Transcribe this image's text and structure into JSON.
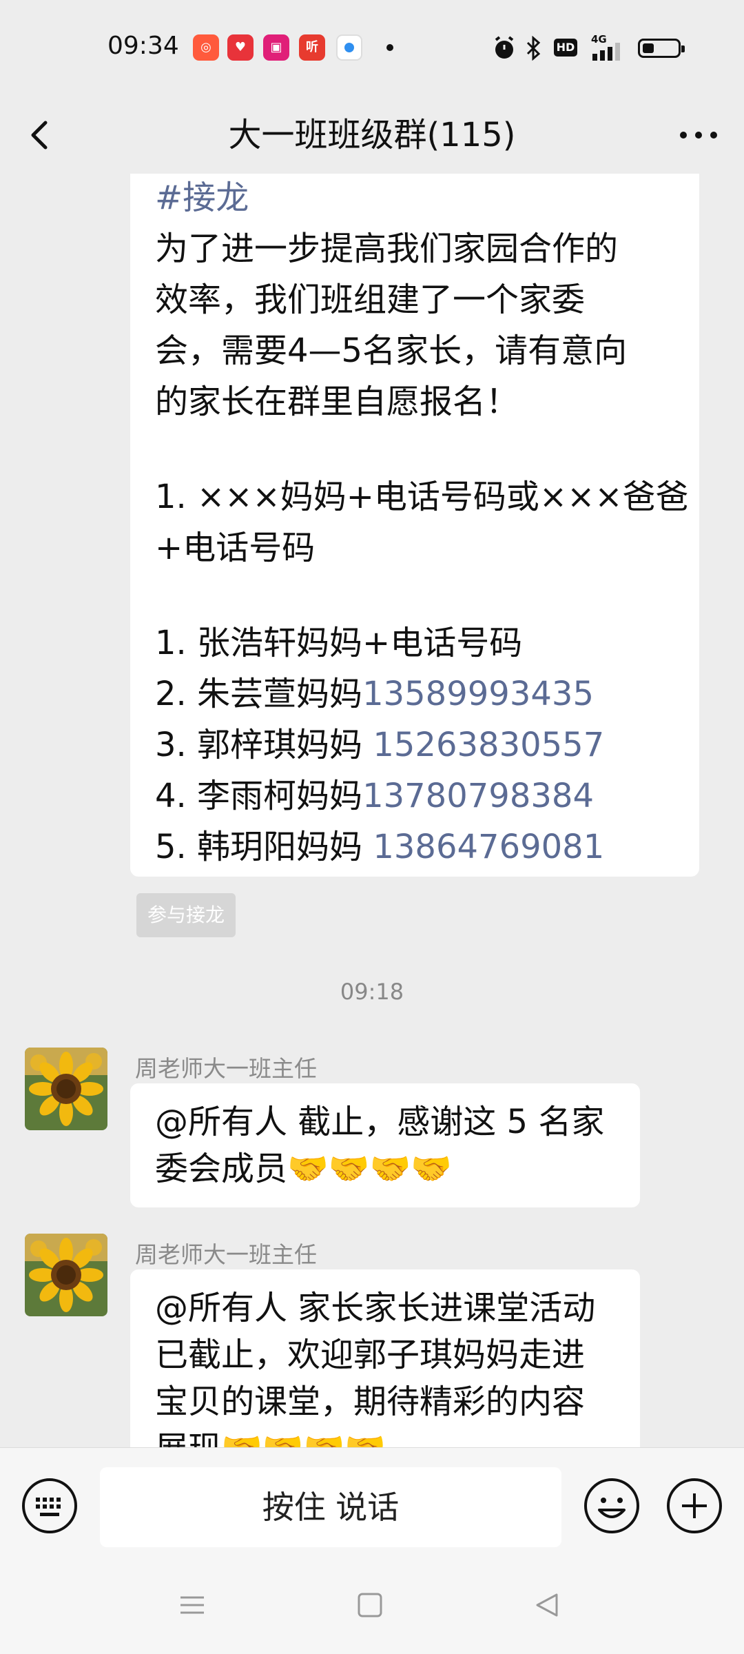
{
  "status_bar": {
    "time": "09:34",
    "apps": [
      {
        "icon": "app-icon-1",
        "color": "#ff5a3c"
      },
      {
        "icon": "app-icon-2",
        "color": "#e8333a"
      },
      {
        "icon": "app-icon-3",
        "color": "#e01f78"
      },
      {
        "icon": "ting-icon",
        "color": "#e73b2f",
        "label": "听"
      },
      {
        "icon": "app-icon-5",
        "color": "#2f8ff0"
      }
    ],
    "hd": "HD",
    "network": "4G"
  },
  "header": {
    "title": "大一班班级群(115)"
  },
  "chat": {
    "jielong_message": {
      "tag": "#接龙",
      "intro_lines": [
        "为了进一步提高我们家园合作的",
        "效率，我们班组建了一个家委",
        "会，需要4—5名家长，请有意向",
        "的家长在群里自愿报名！"
      ],
      "example_lines": [
        "1. ×××妈妈+电话号码或×××爸爸",
        "+电话号码"
      ],
      "entries": [
        {
          "prefix": "1. 张浩轩妈妈+电话号码",
          "phone": ""
        },
        {
          "prefix": "2. 朱芸萱妈妈",
          "phone": "13589993435"
        },
        {
          "prefix": "3. 郭梓琪妈妈 ",
          "phone": "15263830557"
        },
        {
          "prefix": "4. 李雨柯妈妈",
          "phone": "13780798384"
        },
        {
          "prefix": "5. 韩玥阳妈妈 ",
          "phone": "13864769081"
        }
      ]
    },
    "join_button": "参与接龙",
    "timestamp": "09:18",
    "messages": [
      {
        "sender": "周老师大一班主任",
        "lines": [
          "@所有人  截止，感谢这 5 名家",
          "委会成员🤝🤝🤝🤝"
        ]
      },
      {
        "sender": "周老师大一班主任",
        "lines": [
          "@所有人  家长家长进课堂活动",
          "已截止，欢迎郭子琪妈妈走进",
          "宝贝的课堂，期待精彩的内容",
          "展现🤝🤝🤝🤝"
        ]
      }
    ]
  },
  "input_bar": {
    "hold_to_talk": "按住 说话"
  }
}
